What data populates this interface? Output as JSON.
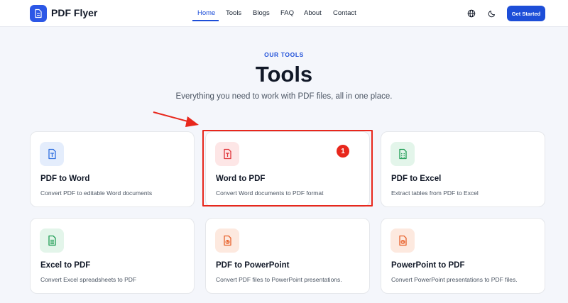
{
  "header": {
    "brand": "PDF Flyer",
    "nav": [
      "Home",
      "Tools",
      "Blogs",
      "FAQ",
      "About",
      "Contact"
    ],
    "active_nav": "Home",
    "cta_label": "Get Started",
    "icons": [
      "globe-icon",
      "moon-icon"
    ]
  },
  "hero": {
    "eyebrow": "OUR TOOLS",
    "title": "Tools",
    "subtitle": "Everything you need to work with PDF files, all in one place."
  },
  "tools": [
    {
      "title": "PDF to Word",
      "desc": "Convert PDF to editable Word documents",
      "icon": "word-file-icon",
      "accent": "#2f6fe0",
      "tint": "#e4edfc"
    },
    {
      "title": "Word to PDF",
      "desc": "Convert Word documents to PDF format",
      "icon": "pdf-file-icon",
      "accent": "#e0353a",
      "tint": "#fde6e6"
    },
    {
      "title": "PDF to Excel",
      "desc": "Extract tables from PDF to Excel",
      "icon": "spreadsheet-file-icon",
      "accent": "#1f9d55",
      "tint": "#e3f5ea"
    },
    {
      "title": "Excel to PDF",
      "desc": "Convert Excel spreadsheets to PDF",
      "icon": "document-file-icon",
      "accent": "#1f9d55",
      "tint": "#e3f5ea"
    },
    {
      "title": "PDF to PowerPoint",
      "desc": "Convert PDF files to PowerPoint presentations.",
      "icon": "presentation-file-icon",
      "accent": "#e8622c",
      "tint": "#fde9df"
    },
    {
      "title": "PowerPoint to PDF",
      "desc": "Convert PowerPoint presentations to PDF files.",
      "icon": "presentation-file-icon",
      "accent": "#e8622c",
      "tint": "#fde9df"
    }
  ],
  "annotation": {
    "badge": "1",
    "color": "#e8271c"
  }
}
